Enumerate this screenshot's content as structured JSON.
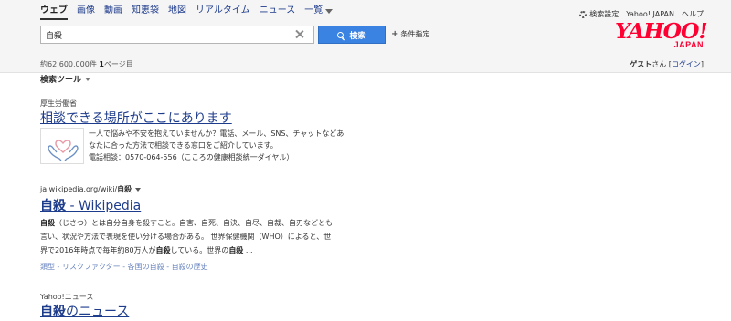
{
  "tabs": [
    {
      "label": "ウェブ",
      "active": true
    },
    {
      "label": "画像"
    },
    {
      "label": "動画"
    },
    {
      "label": "知恵袋"
    },
    {
      "label": "地図"
    },
    {
      "label": "リアルタイム"
    },
    {
      "label": "ニュース"
    },
    {
      "label": "一覧"
    }
  ],
  "top_links": {
    "settings": "検索設定",
    "yahoo_japan": "Yahoo! JAPAN",
    "help": "ヘルプ"
  },
  "logo": {
    "main": "YAHOO!",
    "sub": "JAPAN",
    "color": "#ff0033"
  },
  "search": {
    "query": "自殺",
    "button_label": "検索",
    "condition_label": "条件指定"
  },
  "stats": {
    "count_prefix": "約",
    "count": "62,600,000",
    "count_suffix": "件",
    "page": "1",
    "page_suffix": "ページ目"
  },
  "guest": {
    "name": "ゲスト",
    "honorific": "さん",
    "bracket_open": "[",
    "login": "ログイン",
    "bracket_close": "]"
  },
  "tools_label": "検索ツール",
  "results": {
    "r1": {
      "source": "厚生労働省",
      "title": "相談できる場所がここにあります",
      "line1": "一人で悩みや不安を抱えていませんか？電話、メール、SNS、チャットなどあ",
      "line2": "なたに合った方法で相談できる窓口をご紹介しています。",
      "phone": "電話相談：0570-064-556（こころの健康相談統一ダイヤル）"
    },
    "r2": {
      "url_prefix": "ja.wikipedia.org/wiki/",
      "url_bold": "自殺",
      "title_bold": "自殺",
      "title_rest": " - Wikipedia",
      "l1_bold": "自殺",
      "l1_rest": "（じさつ）とは自分自身を殺すこと。自害、自死、自決、自尽、自裁、自刃などとも",
      "l2": "言い、状況や方法で表現を使い分ける場合がある。 世界保健機関（WHO）によると、世",
      "l3_a": "界で2016年時点で毎年約80万人が",
      "l3_bold1": "自殺",
      "l3_b": "している。世界の",
      "l3_bold2": "自殺",
      "l3_c": " ...",
      "sublinks": [
        "類型",
        "リスクファクター",
        "各国の自殺",
        "自殺の歴史"
      ],
      "sep": " - "
    },
    "r3": {
      "source": "Yahoo!ニュース",
      "title_bold": "自殺",
      "title_rest": "のニュース"
    }
  }
}
